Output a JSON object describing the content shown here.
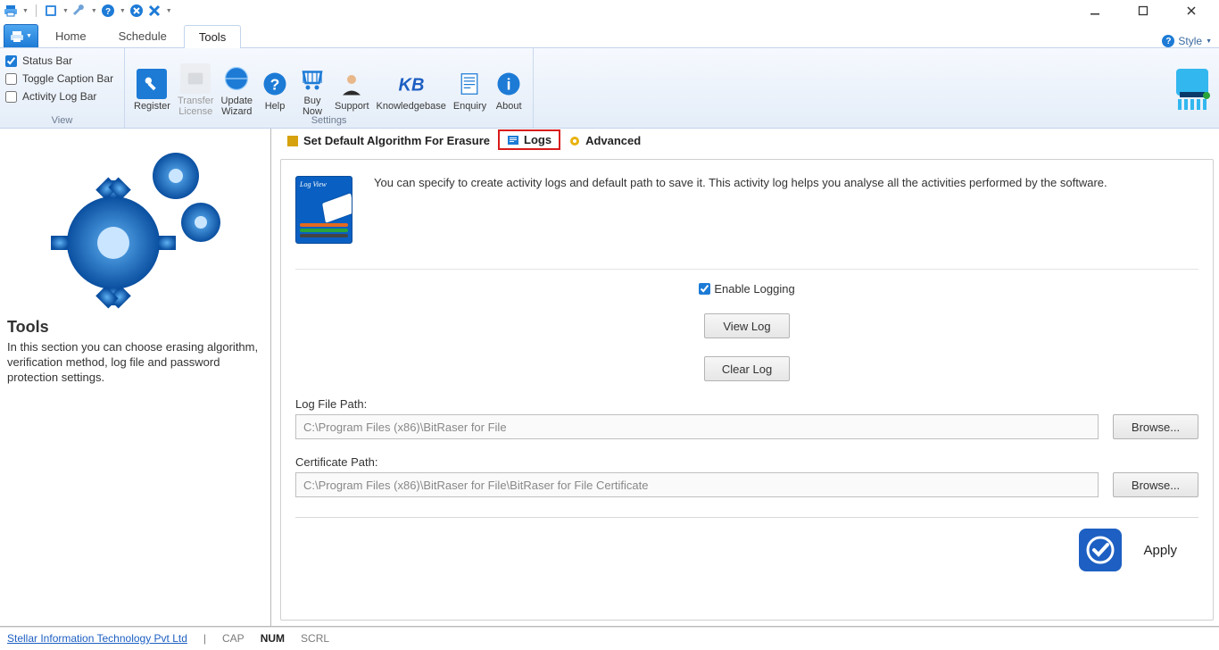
{
  "qat": {
    "icons": [
      "printer",
      "book",
      "wrench",
      "help",
      "close-blue",
      "x-blue"
    ]
  },
  "window": {
    "minimize": "—",
    "maximize": "▢",
    "close": "✕"
  },
  "ribbon": {
    "tabs": {
      "home": "Home",
      "schedule": "Schedule",
      "tools": "Tools"
    },
    "style_label": "Style",
    "view": {
      "status_bar": "Status Bar",
      "toggle_caption": "Toggle Caption Bar",
      "activity_log": "Activity Log Bar",
      "caption": "View"
    },
    "settings": {
      "register": "Register",
      "transfer1": "Transfer",
      "transfer2": "License",
      "update1": "Update",
      "update2": "Wizard",
      "help": "Help",
      "buy1": "Buy",
      "buy2": "Now",
      "support": "Support",
      "kb": "Knowledgebase",
      "enquiry": "Enquiry",
      "about": "About",
      "caption": "Settings"
    }
  },
  "side": {
    "title": "Tools",
    "desc": "In this section you can choose erasing algorithm, verification method, log file and password protection settings."
  },
  "subtabs": {
    "algo": "Set Default Algorithm For Erasure",
    "logs": "Logs",
    "adv": "Advanced"
  },
  "pane": {
    "intro": "You can specify to create activity logs and default path to save it. This activity log helps you analyse all the activities performed by the software.",
    "thumb_title": "Log View",
    "enable_logging": "Enable Logging",
    "view_log": "View Log",
    "clear_log": "Clear Log",
    "log_path_label": "Log File Path:",
    "log_path_value": "C:\\Program Files (x86)\\BitRaser for File",
    "cert_path_label": "Certificate Path:",
    "cert_path_value": "C:\\Program Files (x86)\\BitRaser for File\\BitRaser for File Certificate",
    "browse": "Browse...",
    "apply": "Apply"
  },
  "status": {
    "vendor": "Stellar Information Technology Pvt Ltd",
    "cap": "CAP",
    "num": "NUM",
    "scrl": "SCRL"
  }
}
